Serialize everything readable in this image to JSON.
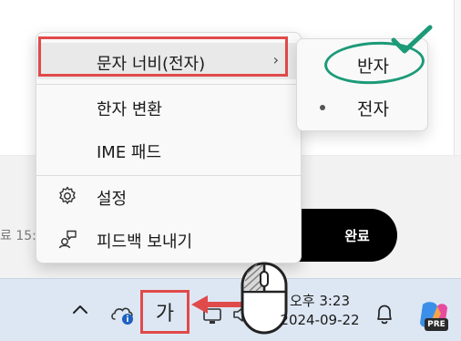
{
  "background": {
    "partial_label": "료 15:",
    "done_button_label": "완료"
  },
  "context_menu": {
    "items": [
      {
        "label": "문자 너비(전자)",
        "has_submenu": true,
        "highlighted": true
      },
      {
        "label": "한자 변환"
      },
      {
        "label": "IME 패드"
      },
      {
        "label": "설정",
        "icon": "gear-icon"
      },
      {
        "label": "피드백 보내기",
        "icon": "feedback-icon"
      }
    ]
  },
  "submenu": {
    "items": [
      {
        "label": "반자",
        "circled": true
      },
      {
        "label": "전자",
        "selected": true
      }
    ]
  },
  "taskbar": {
    "ime_indicator": "가",
    "time": "오후 3:23",
    "date": "2024-09-22",
    "copilot_badge": "PRE"
  },
  "colors": {
    "annotation_red": "#e04a4a",
    "annotation_green": "#1c9a78",
    "taskbar_bg": "#dde7f3",
    "menu_bg": "#f9f9f9",
    "done_button_bg": "#000000"
  }
}
